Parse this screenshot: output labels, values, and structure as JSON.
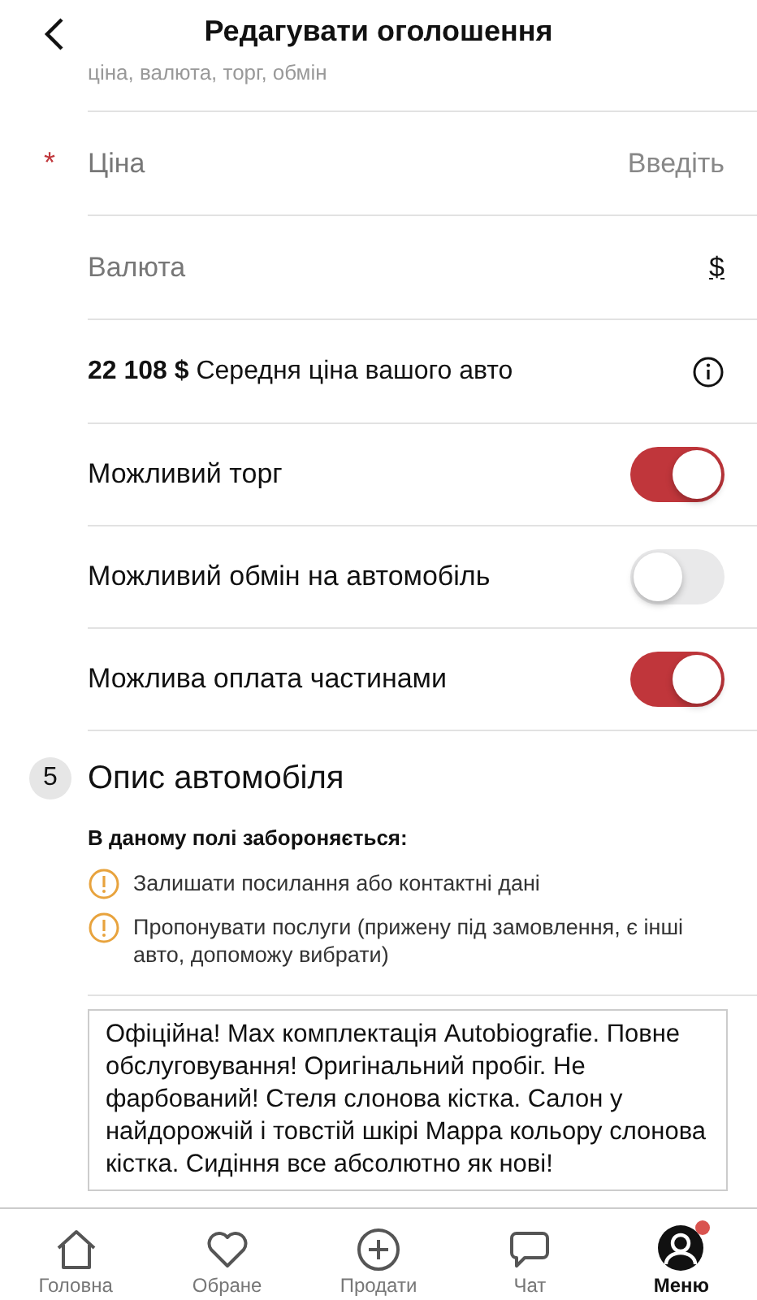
{
  "header": {
    "title": "Редагувати оголошення",
    "subtitle": "ціна, валюта, торг, обмін"
  },
  "fields": [
    {
      "label": "Ціна",
      "required_mark": "*",
      "placeholder": "Введіть",
      "kind": "input"
    },
    {
      "label": "Валюта",
      "value": "$",
      "kind": "select"
    }
  ],
  "average_price": {
    "text": "**22 108 $** Середня ціна вашого авто"
  },
  "toggles": [
    {
      "label": "Можливий торг",
      "on": true
    },
    {
      "label": "Можливий обмін на автомобіль",
      "on": false
    },
    {
      "label": "Можлива оплата частинами",
      "on": true
    }
  ],
  "section": {
    "number": "5",
    "title": "Опис автомобіля"
  },
  "rules": {
    "heading": "В даному полі забороняється:",
    "items": [
      "Залишати посилання або контактні дані",
      "Пропонувати послуги (прижену під замовлення, є інші авто, допоможу вибрати)"
    ]
  },
  "description": {
    "value": "Офіційна! Max комплектація Autobiografie. Повне обслуговування! Оригінальний пробіг. Не фарбований! Стеля слонова кістка. Салон у найдорожчій і товстій шкірі Mappa кольору слонова кістка. Сидіння все абсолютно як нові!"
  },
  "tabbar": [
    {
      "label": "Головна",
      "selected": false,
      "badge": false
    },
    {
      "label": "Обране",
      "selected": false,
      "badge": false
    },
    {
      "label": "Продати",
      "selected": false,
      "badge": false
    },
    {
      "label": "Чат",
      "selected": false,
      "badge": false
    },
    {
      "label": "Меню",
      "selected": true,
      "badge": true
    }
  ]
}
